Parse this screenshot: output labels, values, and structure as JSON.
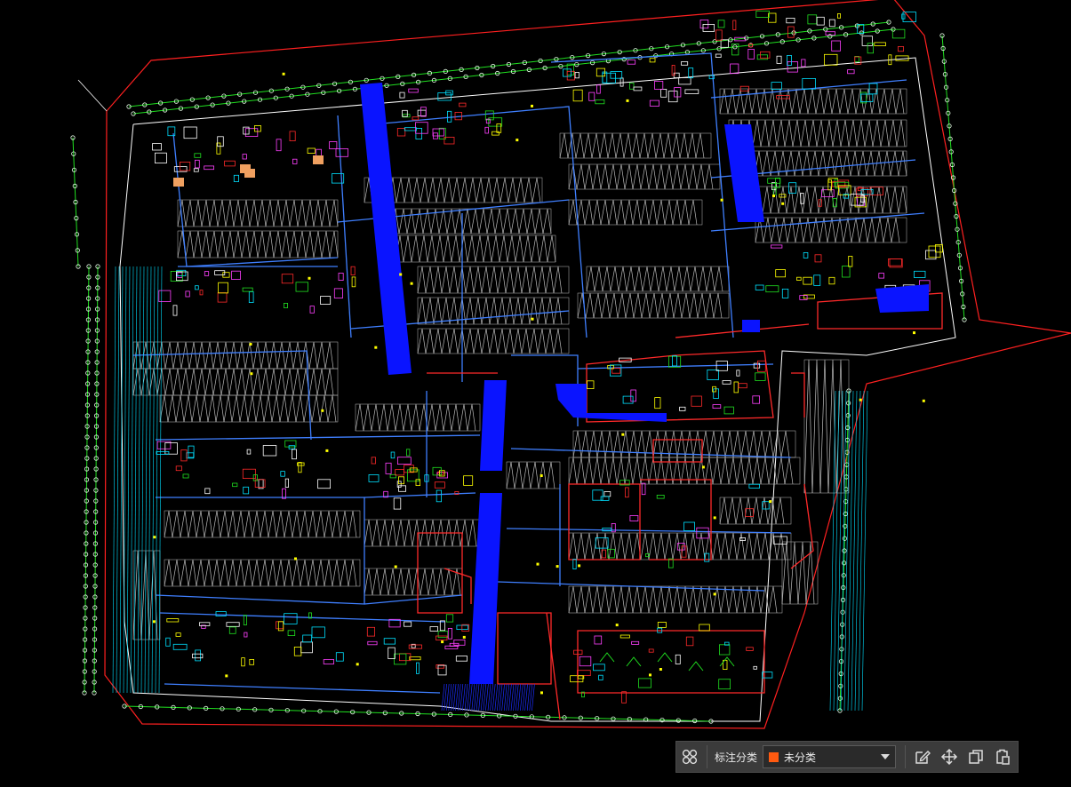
{
  "drawing": {
    "background_color": "#000000",
    "colors": {
      "boundary": "#ff2020",
      "grid_axis": "#20e020",
      "grid_bubble": "#e8ffe8",
      "column_line": "#00e0ff",
      "duct": "#3f7fff",
      "shaft_fill": "#0a14ff",
      "parking_stall": "#bdbdbd",
      "wall": "#ff2a2a",
      "yellow": "#ffff00",
      "magenta": "#ff40ff",
      "white": "#ffffff",
      "orange_fill": "#f0a060"
    },
    "note_lines": [
      "",
      ""
    ]
  },
  "toolbar": {
    "layout_icon": "grid-2x2-icon",
    "label": "标注分类",
    "category_value": "未分类",
    "category_color": "#ff5a10",
    "edit_icon": "edit-icon",
    "move_icon": "move-icon",
    "copy_icon": "copy-icon",
    "paste_icon": "paste-icon"
  }
}
